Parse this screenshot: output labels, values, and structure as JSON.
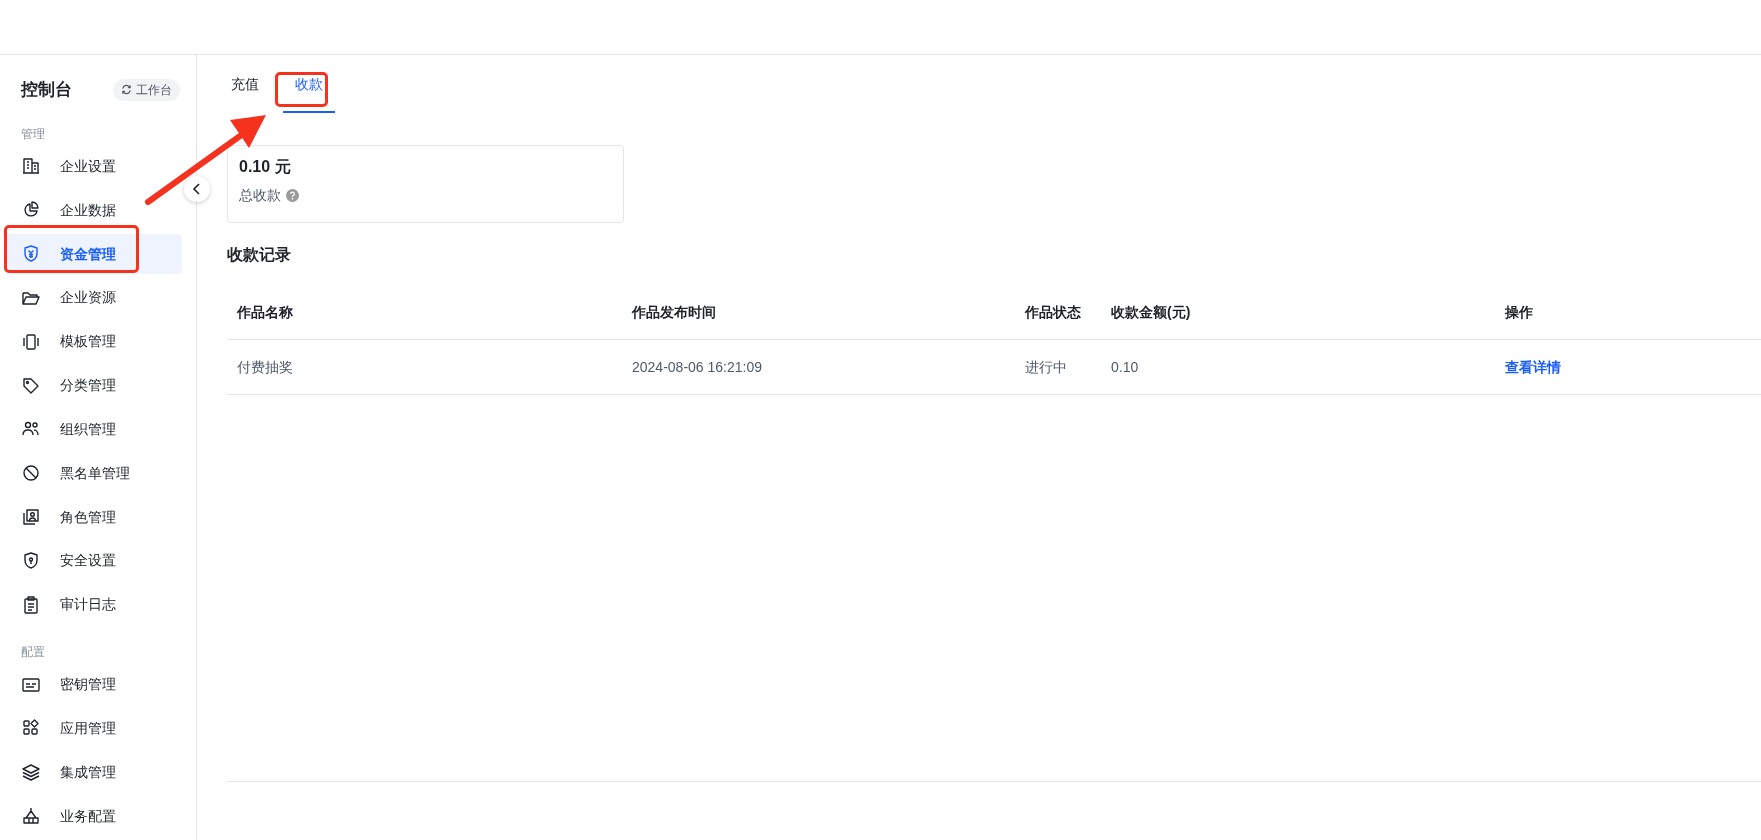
{
  "sidebar": {
    "title": "控制台",
    "workspace_button": "工作台",
    "sections": [
      {
        "label": "管理",
        "items": [
          {
            "label": "企业设置",
            "selected": false
          },
          {
            "label": "企业数据",
            "selected": false
          },
          {
            "label": "资金管理",
            "selected": true
          },
          {
            "label": "企业资源",
            "selected": false
          },
          {
            "label": "模板管理",
            "selected": false
          },
          {
            "label": "分类管理",
            "selected": false
          },
          {
            "label": "组织管理",
            "selected": false
          },
          {
            "label": "黑名单管理",
            "selected": false
          },
          {
            "label": "角色管理",
            "selected": false
          },
          {
            "label": "安全设置",
            "selected": false
          },
          {
            "label": "审计日志",
            "selected": false
          }
        ]
      },
      {
        "label": "配置",
        "items": [
          {
            "label": "密钥管理",
            "selected": false
          },
          {
            "label": "应用管理",
            "selected": false
          },
          {
            "label": "集成管理",
            "selected": false
          },
          {
            "label": "业务配置",
            "selected": false
          }
        ]
      }
    ]
  },
  "tabs": [
    {
      "label": "充值",
      "selected": false
    },
    {
      "label": "收款",
      "selected": true
    }
  ],
  "summary": {
    "amount": "0.10 元",
    "label": "总收款"
  },
  "records": {
    "title": "收款记录",
    "columns": [
      "作品名称",
      "作品发布时间",
      "作品状态",
      "收款金额(元)",
      "操作"
    ],
    "rows": [
      {
        "cells": [
          "付费抽奖",
          "2024-08-06 16:21:09",
          "进行中",
          "0.10"
        ],
        "action": "查看详情"
      }
    ]
  }
}
